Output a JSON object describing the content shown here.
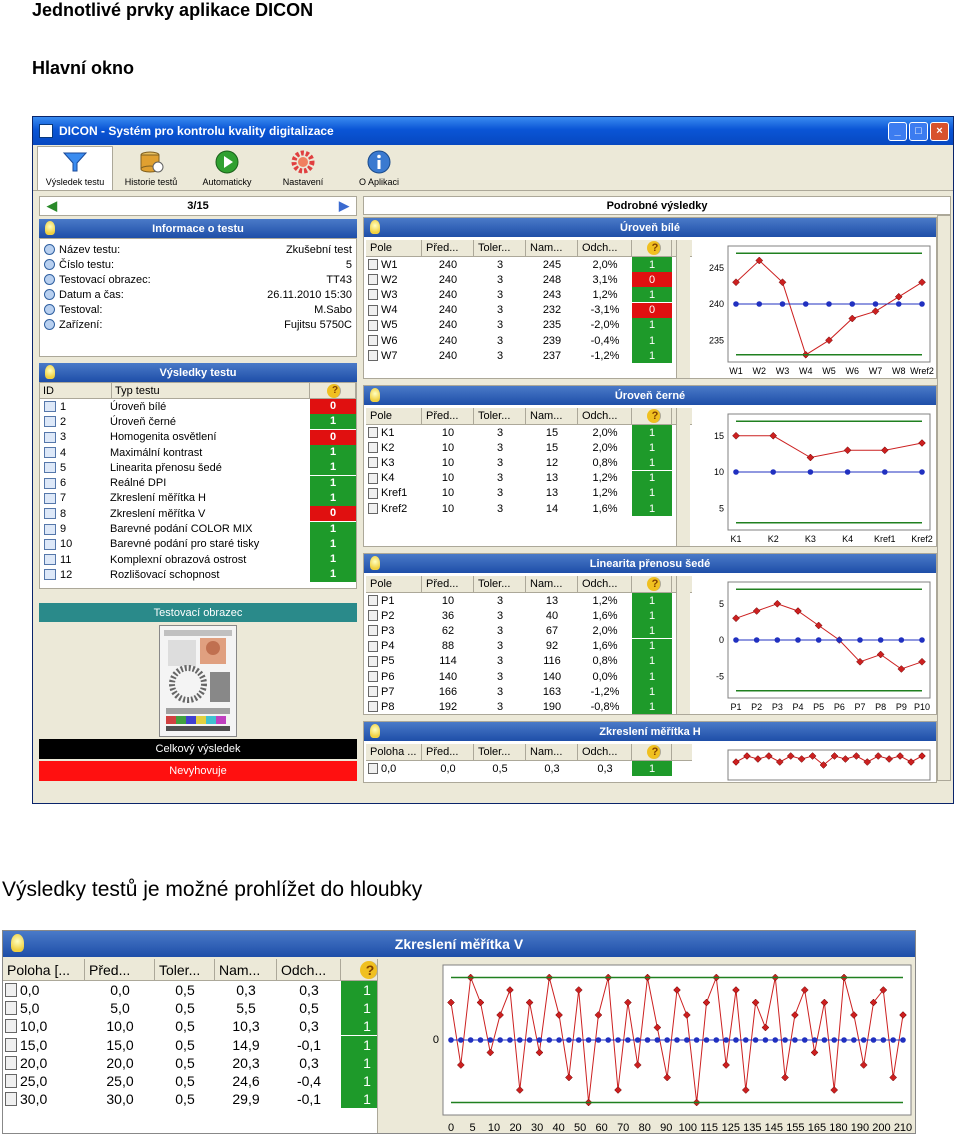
{
  "doc": {
    "heading": "Jednotlivé prvky aplikace DICON",
    "subheading": "Hlavní okno",
    "paragraph": "Výsledky testů je možné prohlížet do hloubky"
  },
  "window": {
    "title": "DICON - Systém pro kontrolu kvality digitalizace",
    "min": "_",
    "max": "□",
    "close": "×"
  },
  "toolbar": [
    {
      "label": "Výsledek testu",
      "icon": "funnel-icon",
      "color": "#3a8cf0"
    },
    {
      "label": "Historie testů",
      "icon": "database-icon",
      "color": "#e0a030"
    },
    {
      "label": "Automaticky",
      "icon": "play-icon",
      "color": "#30a030"
    },
    {
      "label": "Nastavení",
      "icon": "gear-icon",
      "color": "#e04040"
    },
    {
      "label": "O Aplikaci",
      "icon": "info-icon",
      "color": "#3a7ad0"
    }
  ],
  "nav": {
    "counter": "3/15",
    "prev": "◀",
    "next": "▶"
  },
  "info": {
    "title": "Informace o testu",
    "rows": [
      {
        "label": "Název testu:",
        "value": "Zkušební test"
      },
      {
        "label": "Číslo testu:",
        "value": "5"
      },
      {
        "label": "Testovací obrazec:",
        "value": "TT43"
      },
      {
        "label": "Datum a čas:",
        "value": "26.11.2010 15:30"
      },
      {
        "label": "Testoval:",
        "value": "M.Sabo"
      },
      {
        "label": "Zařízení:",
        "value": "Fujitsu 5750C"
      }
    ]
  },
  "results": {
    "title": "Výsledky testu",
    "col_id": "ID",
    "col_type": "Typ testu",
    "col_q": "?",
    "rows": [
      {
        "id": "1",
        "name": "Úroveň bílé",
        "status": "0"
      },
      {
        "id": "2",
        "name": "Úroveň černé",
        "status": "1"
      },
      {
        "id": "3",
        "name": "Homogenita osvětlení",
        "status": "0"
      },
      {
        "id": "4",
        "name": "Maximální kontrast",
        "status": "1"
      },
      {
        "id": "5",
        "name": "Linearita přenosu šedé",
        "status": "1"
      },
      {
        "id": "6",
        "name": "Reálné DPI",
        "status": "1"
      },
      {
        "id": "7",
        "name": "Zkreslení měřítka H",
        "status": "1"
      },
      {
        "id": "8",
        "name": "Zkreslení měřítka V",
        "status": "0"
      },
      {
        "id": "9",
        "name": "Barevné podání COLOR MIX",
        "status": "1"
      },
      {
        "id": "10",
        "name": "Barevné podání pro staré tisky",
        "status": "1"
      },
      {
        "id": "11",
        "name": "Komplexní obrazová ostrost",
        "status": "1"
      },
      {
        "id": "12",
        "name": "Rozlišovací schopnost",
        "status": "1"
      }
    ]
  },
  "test_image": {
    "title": "Testovací obrazec"
  },
  "overall": {
    "title": "Celkový výsledek",
    "verdict": "Nevyhovuje"
  },
  "detail": {
    "title": "Podrobné výsledky"
  },
  "sections": [
    {
      "title": "Úroveň bílé",
      "headers": [
        "Pole",
        "Před...",
        "Toler...",
        "Nam...",
        "Odch...",
        "?"
      ],
      "rows": [
        [
          "W1",
          "240",
          "3",
          "245",
          "2,0%",
          "1"
        ],
        [
          "W2",
          "240",
          "3",
          "248",
          "3,1%",
          "0"
        ],
        [
          "W3",
          "240",
          "3",
          "243",
          "1,2%",
          "1"
        ],
        [
          "W4",
          "240",
          "3",
          "232",
          "-3,1%",
          "0"
        ],
        [
          "W5",
          "240",
          "3",
          "235",
          "-2,0%",
          "1"
        ],
        [
          "W6",
          "240",
          "3",
          "239",
          "-0,4%",
          "1"
        ],
        [
          "W7",
          "240",
          "3",
          "237",
          "-1,2%",
          "1"
        ]
      ]
    },
    {
      "title": "Úroveň černé",
      "headers": [
        "Pole",
        "Před...",
        "Toler...",
        "Nam...",
        "Odch...",
        "?"
      ],
      "rows": [
        [
          "K1",
          "10",
          "3",
          "15",
          "2,0%",
          "1"
        ],
        [
          "K2",
          "10",
          "3",
          "15",
          "2,0%",
          "1"
        ],
        [
          "K3",
          "10",
          "3",
          "12",
          "0,8%",
          "1"
        ],
        [
          "K4",
          "10",
          "3",
          "13",
          "1,2%",
          "1"
        ],
        [
          "Kref1",
          "10",
          "3",
          "13",
          "1,2%",
          "1"
        ],
        [
          "Kref2",
          "10",
          "3",
          "14",
          "1,6%",
          "1"
        ]
      ]
    },
    {
      "title": "Linearita přenosu šedé",
      "headers": [
        "Pole",
        "Před...",
        "Toler...",
        "Nam...",
        "Odch...",
        "?"
      ],
      "rows": [
        [
          "P1",
          "10",
          "3",
          "13",
          "1,2%",
          "1"
        ],
        [
          "P2",
          "36",
          "3",
          "40",
          "1,6%",
          "1"
        ],
        [
          "P3",
          "62",
          "3",
          "67",
          "2,0%",
          "1"
        ],
        [
          "P4",
          "88",
          "3",
          "92",
          "1,6%",
          "1"
        ],
        [
          "P5",
          "114",
          "3",
          "116",
          "0,8%",
          "1"
        ],
        [
          "P6",
          "140",
          "3",
          "140",
          "0,0%",
          "1"
        ],
        [
          "P7",
          "166",
          "3",
          "163",
          "-1,2%",
          "1"
        ],
        [
          "P8",
          "192",
          "3",
          "190",
          "-0,8%",
          "1"
        ]
      ]
    },
    {
      "title": "Zkreslení měřítka H",
      "headers": [
        "Poloha ...",
        "Před...",
        "Toler...",
        "Nam...",
        "Odch...",
        "?"
      ],
      "rows": [
        [
          "0,0",
          "0,0",
          "0,5",
          "0,3",
          "0,3",
          "1"
        ]
      ]
    }
  ],
  "section_v": {
    "title": "Zkreslení měřítka V",
    "headers": [
      "Poloha [...",
      "Před...",
      "Toler...",
      "Nam...",
      "Odch...",
      "?"
    ],
    "rows": [
      [
        "0,0",
        "0,0",
        "0,5",
        "0,3",
        "0,3",
        "1"
      ],
      [
        "5,0",
        "5,0",
        "0,5",
        "5,5",
        "0,5",
        "1"
      ],
      [
        "10,0",
        "10,0",
        "0,5",
        "10,3",
        "0,3",
        "1"
      ],
      [
        "15,0",
        "15,0",
        "0,5",
        "14,9",
        "-0,1",
        "1"
      ],
      [
        "20,0",
        "20,0",
        "0,5",
        "20,3",
        "0,3",
        "1"
      ],
      [
        "25,0",
        "25,0",
        "0,5",
        "24,6",
        "-0,4",
        "1"
      ],
      [
        "30,0",
        "30,0",
        "0,5",
        "29,9",
        "-0,1",
        "1"
      ]
    ]
  },
  "chart_data": [
    {
      "type": "line",
      "categories": [
        "W1",
        "W2",
        "W3",
        "W4",
        "W5",
        "W6",
        "W7",
        "W8",
        "Wref2"
      ],
      "series": [
        {
          "values": [
            243,
            246,
            243,
            233,
            235,
            238,
            239,
            241,
            243
          ],
          "color": "#cc2020"
        },
        {
          "values": [
            240,
            240,
            240,
            240,
            240,
            240,
            240,
            240,
            240
          ],
          "color": "#2030c0"
        },
        {
          "values": [
            247,
            247,
            247,
            247,
            247,
            247,
            247,
            247,
            247
          ],
          "color": "#208020"
        },
        {
          "values": [
            233,
            233,
            233,
            233,
            233,
            233,
            233,
            233,
            233
          ],
          "color": "#208020"
        }
      ],
      "yticks": [
        245,
        240,
        235
      ],
      "ylim": [
        232,
        248
      ]
    },
    {
      "type": "line",
      "categories": [
        "K1",
        "K2",
        "K3",
        "K4",
        "Kref1",
        "Kref2"
      ],
      "series": [
        {
          "values": [
            15,
            15,
            12,
            13,
            13,
            14
          ],
          "color": "#cc2020"
        },
        {
          "values": [
            10,
            10,
            10,
            10,
            10,
            10
          ],
          "color": "#2030c0"
        },
        {
          "values": [
            17,
            17,
            17,
            17,
            17,
            17
          ],
          "color": "#208020"
        },
        {
          "values": [
            3,
            3,
            3,
            3,
            3,
            3
          ],
          "color": "#208020"
        }
      ],
      "yticks": [
        15,
        10,
        5
      ],
      "ylim": [
        2,
        18
      ]
    },
    {
      "type": "line",
      "categories": [
        "P1",
        "P2",
        "P3",
        "P4",
        "P5",
        "P6",
        "P7",
        "P8",
        "P9",
        "P10"
      ],
      "series": [
        {
          "values": [
            3,
            4,
            5,
            4,
            2,
            0,
            -3,
            -2,
            -4,
            -3
          ],
          "color": "#cc2020"
        },
        {
          "values": [
            0,
            0,
            0,
            0,
            0,
            0,
            0,
            0,
            0,
            0
          ],
          "color": "#2030c0"
        },
        {
          "values": [
            7,
            7,
            7,
            7,
            7,
            7,
            7,
            7,
            7,
            7
          ],
          "color": "#208020"
        },
        {
          "values": [
            -7,
            -7,
            -7,
            -7,
            -7,
            -7,
            -7,
            -7,
            -7,
            -7
          ],
          "color": "#208020"
        }
      ],
      "yticks": [
        5,
        0,
        -5
      ],
      "ylim": [
        -8,
        8
      ]
    },
    {
      "type": "line",
      "categories": [],
      "series": [
        {
          "values": [
            0.1,
            0.3,
            0.2,
            0.3,
            0.1,
            0.3,
            0.2,
            0.3,
            0.0,
            0.3,
            0.2,
            0.3,
            0.1,
            0.3,
            0.2,
            0.3,
            0.1,
            0.3
          ],
          "color": "#cc2020"
        }
      ],
      "yticks": [],
      "ylim": [
        -0.5,
        0.5
      ]
    },
    {
      "type": "line",
      "categories": [
        "0",
        "5",
        "10",
        "20",
        "30",
        "40",
        "50",
        "60",
        "70",
        "80",
        "90",
        "100",
        "115",
        "125",
        "135",
        "145",
        "155",
        "165",
        "180",
        "190",
        "200",
        "210"
      ],
      "series": [
        {
          "values": [
            0.3,
            -0.2,
            0.5,
            0.3,
            -0.1,
            0.2,
            0.4,
            -0.4,
            0.3,
            -0.1,
            0.5,
            0.2,
            -0.3,
            0.4,
            -0.5,
            0.2,
            0.5,
            -0.4,
            0.3,
            -0.2,
            0.5,
            0.1,
            -0.3,
            0.4,
            0.2,
            -0.5,
            0.3,
            0.5,
            -0.2,
            0.4,
            -0.4,
            0.3,
            0.1,
            0.5,
            -0.3,
            0.2,
            0.4,
            -0.1,
            0.3,
            -0.4,
            0.5,
            0.2,
            -0.2,
            0.3,
            0.4,
            -0.3,
            0.2
          ],
          "color": "#cc2020"
        },
        {
          "values": [
            0,
            0,
            0,
            0,
            0,
            0,
            0,
            0,
            0,
            0,
            0,
            0,
            0,
            0,
            0,
            0,
            0,
            0,
            0,
            0,
            0,
            0,
            0,
            0,
            0,
            0,
            0,
            0,
            0,
            0,
            0,
            0,
            0,
            0,
            0,
            0,
            0,
            0,
            0,
            0,
            0,
            0,
            0,
            0,
            0,
            0,
            0
          ],
          "color": "#2030c0"
        },
        {
          "values": [
            0.5,
            0.5
          ],
          "color": "#208020"
        },
        {
          "values": [
            -0.5,
            -0.5
          ],
          "color": "#208020"
        }
      ],
      "yticks": [
        0
      ],
      "ylim": [
        -0.6,
        0.6
      ]
    }
  ]
}
